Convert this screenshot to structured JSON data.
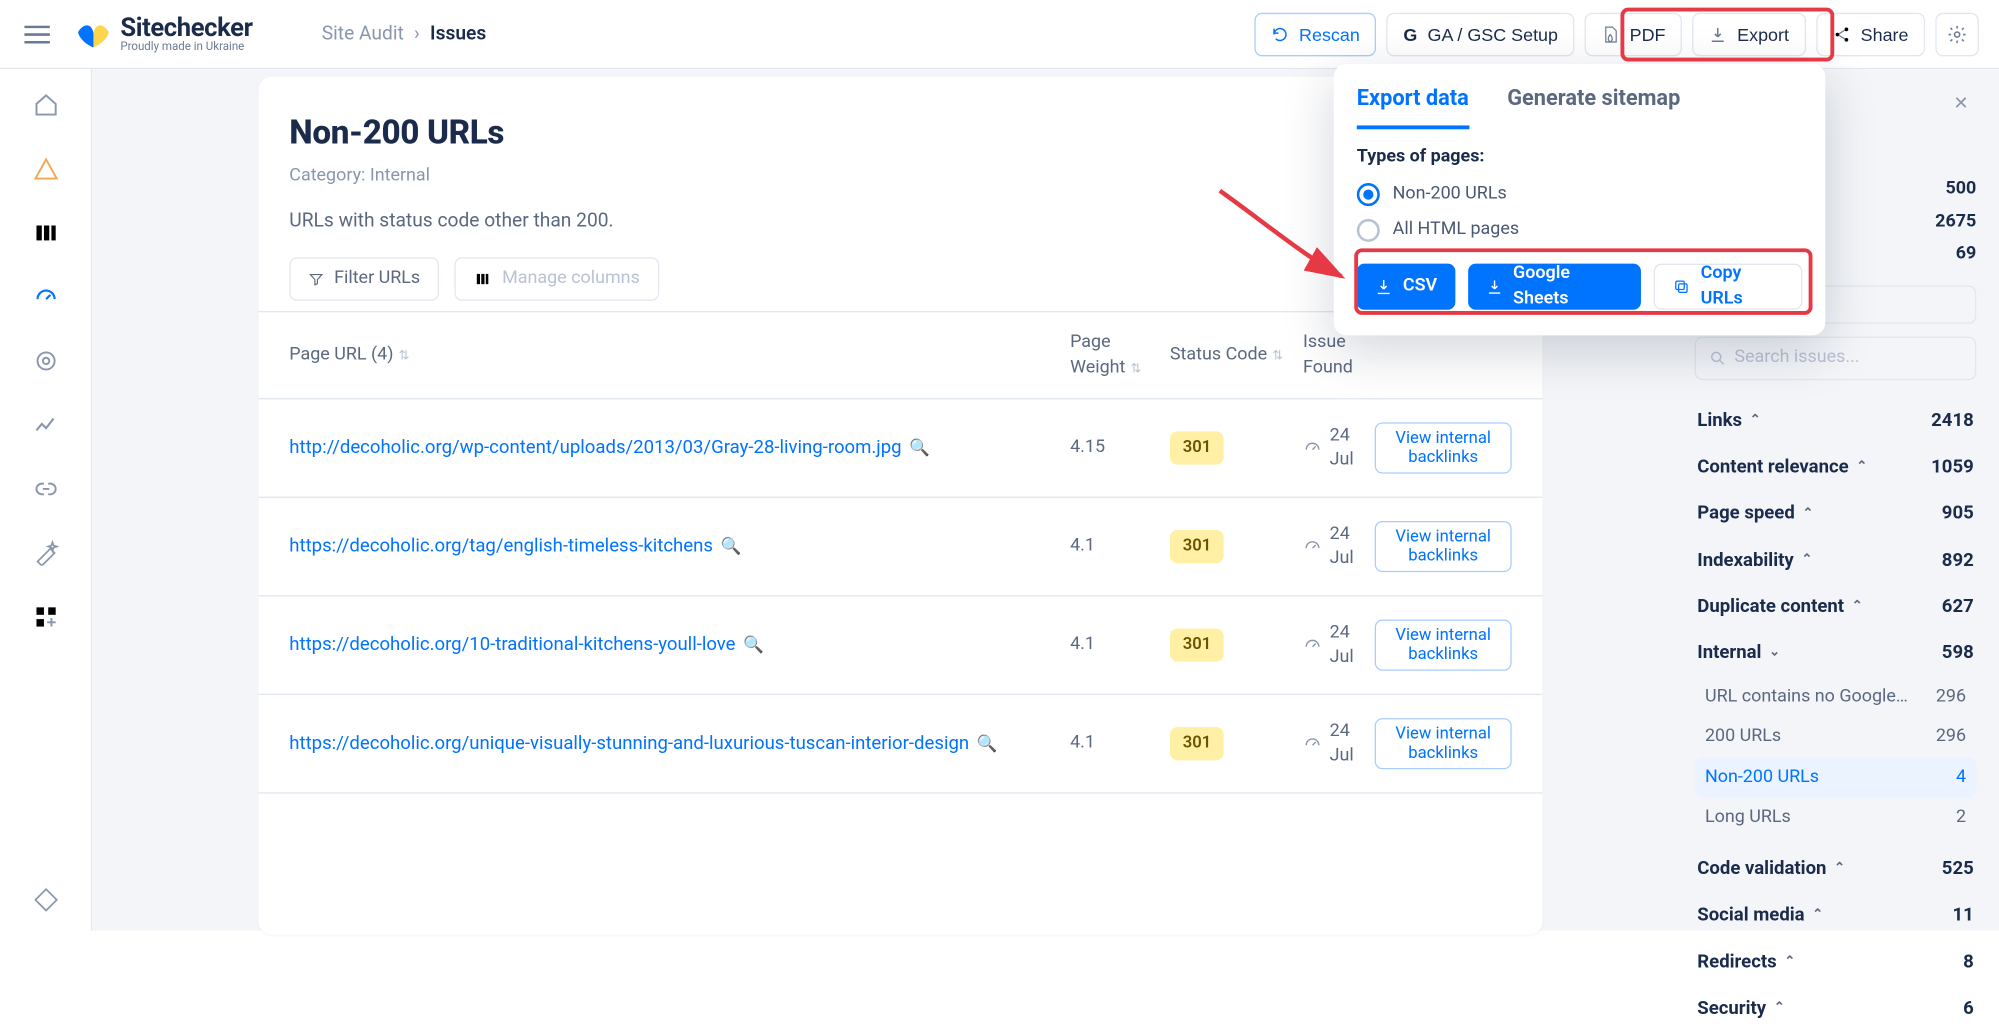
{
  "logo": {
    "name": "Sitechecker",
    "tagline": "Proudly made in Ukraine"
  },
  "breadcrumb": {
    "root": "Site Audit",
    "sep": "›",
    "current": "Issues"
  },
  "header_buttons": {
    "rescan": "Rescan",
    "gsc": "GA / GSC Setup",
    "pdf": "PDF",
    "export": "Export",
    "share": "Share"
  },
  "page": {
    "title": "Non-200 URLs",
    "category_label": "Category: Internal",
    "description": "URLs with status code other than 200."
  },
  "filters": {
    "filter": "Filter URLs",
    "manage": "Manage columns"
  },
  "table": {
    "headers": {
      "url": "Page URL (4)",
      "weight": "Page Weight",
      "status": "Status Code",
      "found": "Issue Found"
    },
    "view_btn": "View internal backlinks",
    "rows": [
      {
        "url": "http://decoholic.org/wp-content/uploads/2013/03/Gray-28-living-room.jpg",
        "weight": "4.15",
        "status": "301",
        "found": "24 Jul"
      },
      {
        "url": "https://decoholic.org/tag/english-timeless-kitchens",
        "weight": "4.1",
        "status": "301",
        "found": "24 Jul"
      },
      {
        "url": "https://decoholic.org/10-traditional-kitchens-youll-love",
        "weight": "4.1",
        "status": "301",
        "found": "24 Jul"
      },
      {
        "url": "https://decoholic.org/unique-visually-stunning-and-luxurious-tuscan-interior-design",
        "weight": "4.1",
        "status": "301",
        "found": "24 Jul"
      }
    ]
  },
  "popover": {
    "tab1": "Export data",
    "tab2": "Generate sitemap",
    "types_label": "Types of pages:",
    "opt1": "Non-200 URLs",
    "opt2": "All HTML pages",
    "csv": "CSV",
    "sheets": "Google Sheets",
    "copy": "Copy URLs"
  },
  "sidebar": {
    "top_partial": "500",
    "row1": "2675",
    "row2": "69",
    "search_placeholder": "Search issues...",
    "groups": [
      {
        "name": "Links",
        "count": "2418",
        "open": false
      },
      {
        "name": "Content relevance",
        "count": "1059",
        "open": false
      },
      {
        "name": "Page speed",
        "count": "905",
        "open": false
      },
      {
        "name": "Indexability",
        "count": "892",
        "open": false
      },
      {
        "name": "Duplicate content",
        "count": "627",
        "open": false
      },
      {
        "name": "Internal",
        "count": "598",
        "open": true,
        "items": [
          {
            "name": "URL contains no Google Tag M…",
            "count": "296"
          },
          {
            "name": "200 URLs",
            "count": "296"
          },
          {
            "name": "Non-200 URLs",
            "count": "4",
            "sel": true
          },
          {
            "name": "Long URLs",
            "count": "2"
          }
        ]
      },
      {
        "name": "Code validation",
        "count": "525",
        "open": false
      },
      {
        "name": "Social media",
        "count": "11",
        "open": false
      },
      {
        "name": "Redirects",
        "count": "8",
        "open": false
      },
      {
        "name": "Security",
        "count": "6",
        "open": false
      }
    ]
  }
}
